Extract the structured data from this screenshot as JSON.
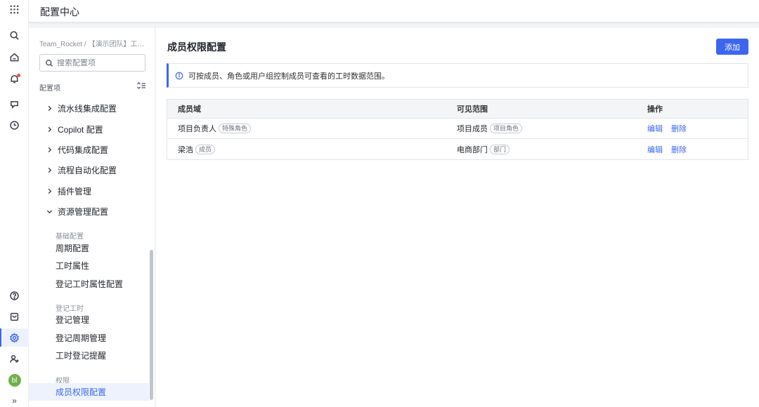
{
  "header": {
    "title": "配置中心"
  },
  "rail": {
    "icons": [
      "apps-grid-icon",
      "search-icon",
      "home-icon",
      "bell-icon",
      "rocket-icon",
      "clock-icon",
      "help-icon",
      "inbox-icon",
      "settings-icon",
      "add-user-icon",
      "avatar",
      "expand-icon"
    ],
    "avatar_text": "bl",
    "expand_glyph": "»"
  },
  "sidebar": {
    "breadcrumb": "Team_Rocket / 【演示团队】工时...",
    "search_placeholder": "搜索配置项",
    "section_label": "配置项",
    "items": [
      {
        "label": "流水线集成配置",
        "expanded": false
      },
      {
        "label": "Copilot 配置",
        "expanded": false
      },
      {
        "label": "代码集成配置",
        "expanded": false
      },
      {
        "label": "流程自动化配置",
        "expanded": false
      },
      {
        "label": "插件管理",
        "expanded": false
      },
      {
        "label": "资源管理配置",
        "expanded": true
      }
    ],
    "groups": [
      {
        "label": "基础配置",
        "children": [
          "周期配置",
          "工时属性",
          "登记工时属性配置"
        ]
      },
      {
        "label": "登记工时",
        "children": [
          "登记管理",
          "登记周期管理",
          "工时登记提醒"
        ]
      },
      {
        "label": "权限",
        "children": [
          "成员权限配置"
        ]
      }
    ],
    "active_item": "成员权限配置"
  },
  "main": {
    "title": "成员权限配置",
    "add_button": "添加",
    "notice": "可按成员、角色或用户组控制成员可查看的工时数据范围。",
    "table": {
      "columns": [
        "成员域",
        "可见范围",
        "操作"
      ],
      "rows": [
        {
          "member": "项目负责人",
          "member_tag": "特殊角色",
          "scope": "项目成员",
          "scope_tag": "项目角色",
          "actions": [
            "编辑",
            "删除"
          ]
        },
        {
          "member": "梁浩",
          "member_tag": "成员",
          "scope": "电商部门",
          "scope_tag": "部门",
          "actions": [
            "编辑",
            "删除"
          ]
        }
      ]
    }
  },
  "colors": {
    "accent": "#3d66ef",
    "notification_dot": "#f24b4b",
    "avatar_bg": "#6fb04c"
  }
}
